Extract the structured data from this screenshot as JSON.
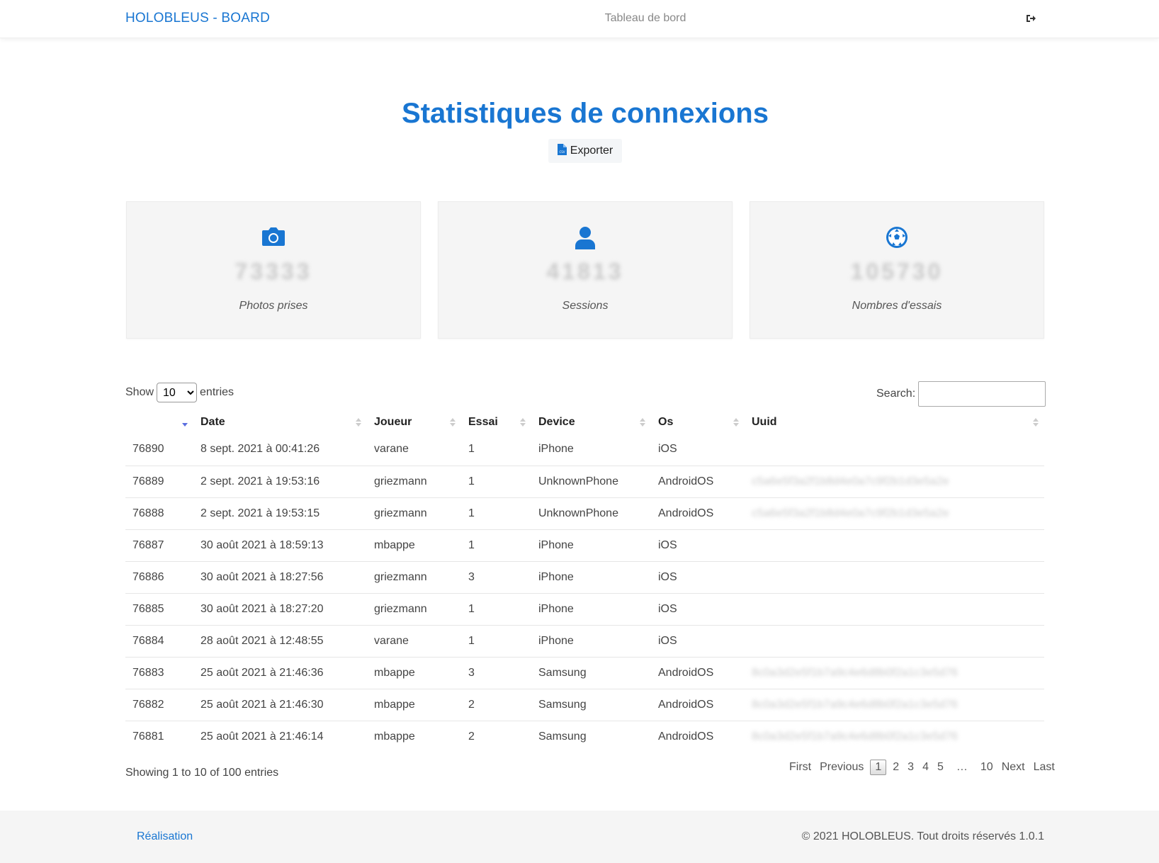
{
  "header": {
    "brand": "HOLOBLEUS - BOARD",
    "center_link": "Tableau de bord",
    "logout_icon": "sign-out-icon"
  },
  "main": {
    "title": "Statistiques de connexions",
    "export_label": "Exporter",
    "export_icon": "csv-file-icon"
  },
  "cards": [
    {
      "icon": "camera-icon",
      "value": "73333",
      "label": "Photos prises"
    },
    {
      "icon": "user-icon",
      "value": "41813",
      "label": "Sessions"
    },
    {
      "icon": "soccer-ball-icon",
      "value": "105730",
      "label": "Nombres d'essais"
    }
  ],
  "table_controls": {
    "show_label": "Show",
    "entries_label": "entries",
    "page_length": "10",
    "page_length_options": [
      "10"
    ],
    "search_label": "Search:",
    "search_value": ""
  },
  "table": {
    "columns": [
      "",
      "Date",
      "Joueur",
      "Essai",
      "Device",
      "Os",
      "Uuid"
    ],
    "rows": [
      {
        "id": "76890",
        "date": "8 sept. 2021 à 00:41:26",
        "joueur": "varane",
        "essai": "1",
        "device": "iPhone",
        "os": "iOS",
        "uuid": ""
      },
      {
        "id": "76889",
        "date": "2 sept. 2021 à 19:53:16",
        "joueur": "griezmann",
        "essai": "1",
        "device": "UnknownPhone",
        "os": "AndroidOS",
        "uuid": "c5a6e5f3a2f1b8d4e0a7c9f2b1d3e5a2e"
      },
      {
        "id": "76888",
        "date": "2 sept. 2021 à 19:53:15",
        "joueur": "griezmann",
        "essai": "1",
        "device": "UnknownPhone",
        "os": "AndroidOS",
        "uuid": "c5a6e5f3a2f1b8d4e0a7c9f2b1d3e5a2e"
      },
      {
        "id": "76887",
        "date": "30 août 2021 à 18:59:13",
        "joueur": "mbappe",
        "essai": "1",
        "device": "iPhone",
        "os": "iOS",
        "uuid": ""
      },
      {
        "id": "76886",
        "date": "30 août 2021 à 18:27:56",
        "joueur": "griezmann",
        "essai": "3",
        "device": "iPhone",
        "os": "iOS",
        "uuid": ""
      },
      {
        "id": "76885",
        "date": "30 août 2021 à 18:27:20",
        "joueur": "griezmann",
        "essai": "1",
        "device": "iPhone",
        "os": "iOS",
        "uuid": ""
      },
      {
        "id": "76884",
        "date": "28 août 2021 à 12:48:55",
        "joueur": "varane",
        "essai": "1",
        "device": "iPhone",
        "os": "iOS",
        "uuid": ""
      },
      {
        "id": "76883",
        "date": "25 août 2021 à 21:46:36",
        "joueur": "mbappe",
        "essai": "3",
        "device": "Samsung",
        "os": "AndroidOS",
        "uuid": "8c0a3d2e5f1b7a9c4e6d8b0f2a1c3e5d76"
      },
      {
        "id": "76882",
        "date": "25 août 2021 à 21:46:30",
        "joueur": "mbappe",
        "essai": "2",
        "device": "Samsung",
        "os": "AndroidOS",
        "uuid": "8c0a3d2e5f1b7a9c4e6d8b0f2a1c3e5d76"
      },
      {
        "id": "76881",
        "date": "25 août 2021 à 21:46:14",
        "joueur": "mbappe",
        "essai": "2",
        "device": "Samsung",
        "os": "AndroidOS",
        "uuid": "8c0a3d2e5f1b7a9c4e6d8b0f2a1c3e5d76"
      }
    ]
  },
  "table_footer": {
    "info": "Showing 1 to 10 of 100 entries",
    "first": "First",
    "previous": "Previous",
    "pages": [
      "1",
      "2",
      "3",
      "4",
      "5"
    ],
    "ellipsis": "…",
    "last_page": "10",
    "next": "Next",
    "last": "Last"
  },
  "footer": {
    "link": "Réalisation",
    "copyright": "© 2021 HOLOBLEUS. Tout droits réservés 1.0.1"
  },
  "colors": {
    "accent": "#1976d2",
    "card_bg": "#f5f5f5",
    "footer_bg": "#f5f5f5"
  }
}
